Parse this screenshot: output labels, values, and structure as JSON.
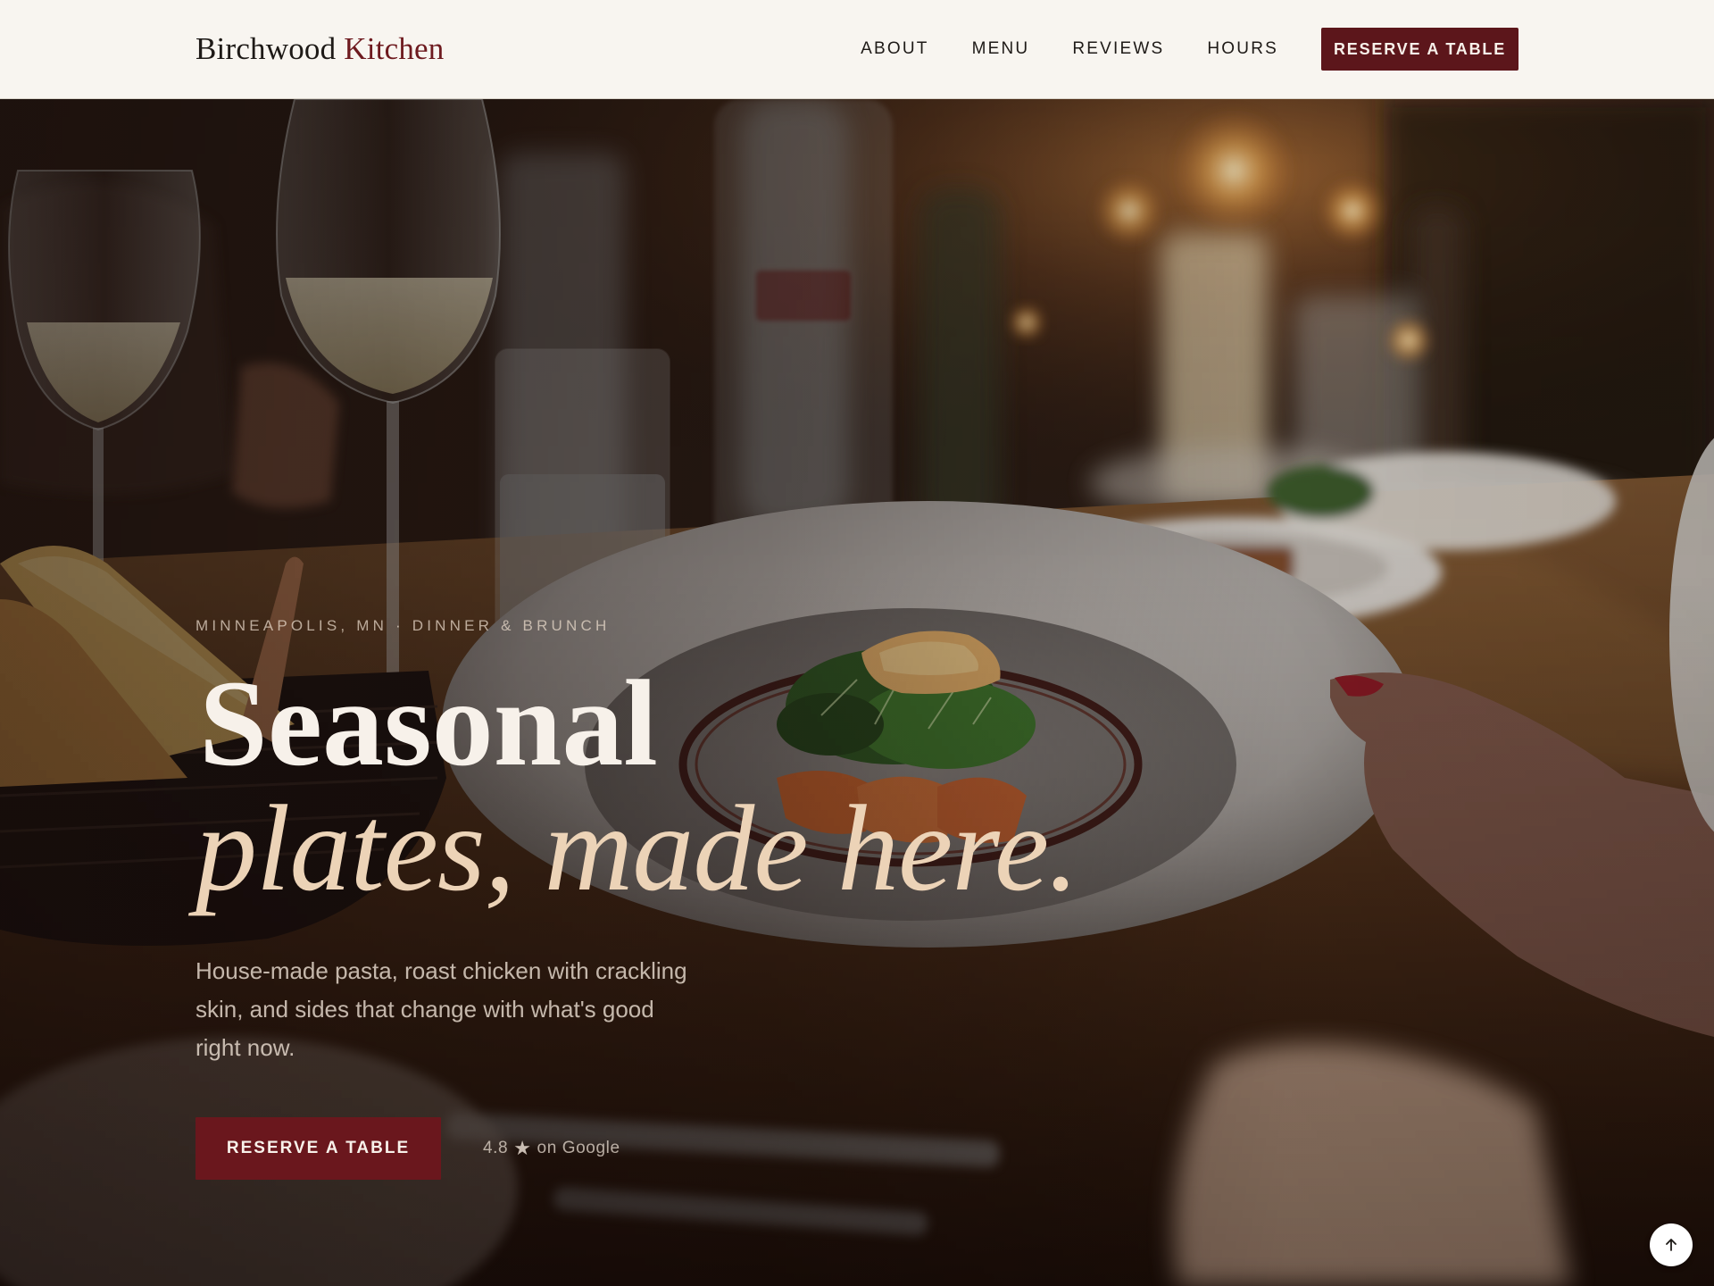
{
  "brand": {
    "name_primary": "Birchwood",
    "name_accent": "Kitchen"
  },
  "nav": {
    "items": [
      {
        "label": "ABOUT"
      },
      {
        "label": "MENU"
      },
      {
        "label": "REVIEWS"
      },
      {
        "label": "HOURS"
      }
    ],
    "cta_label": "RESERVE A TABLE"
  },
  "hero": {
    "eyebrow": "MINNEAPOLIS, MN · DINNER & BRUNCH",
    "title_line1": "Seasonal",
    "title_line2": "plates, made here.",
    "subtitle": "House-made pasta, roast chicken with crackling skin, and sides that change with what's good right now.",
    "cta_label": "RESERVE A TABLE",
    "rating_value": "4.8",
    "rating_star": "★",
    "rating_source": "on Google"
  },
  "icons": {
    "scroll_top": "arrow-up-icon"
  },
  "colors": {
    "header_bg": "#f8f5f0",
    "brand_accent": "#6e1a1f",
    "cta_bg": "#5c161b",
    "title_italic": "#ecd3b7"
  }
}
